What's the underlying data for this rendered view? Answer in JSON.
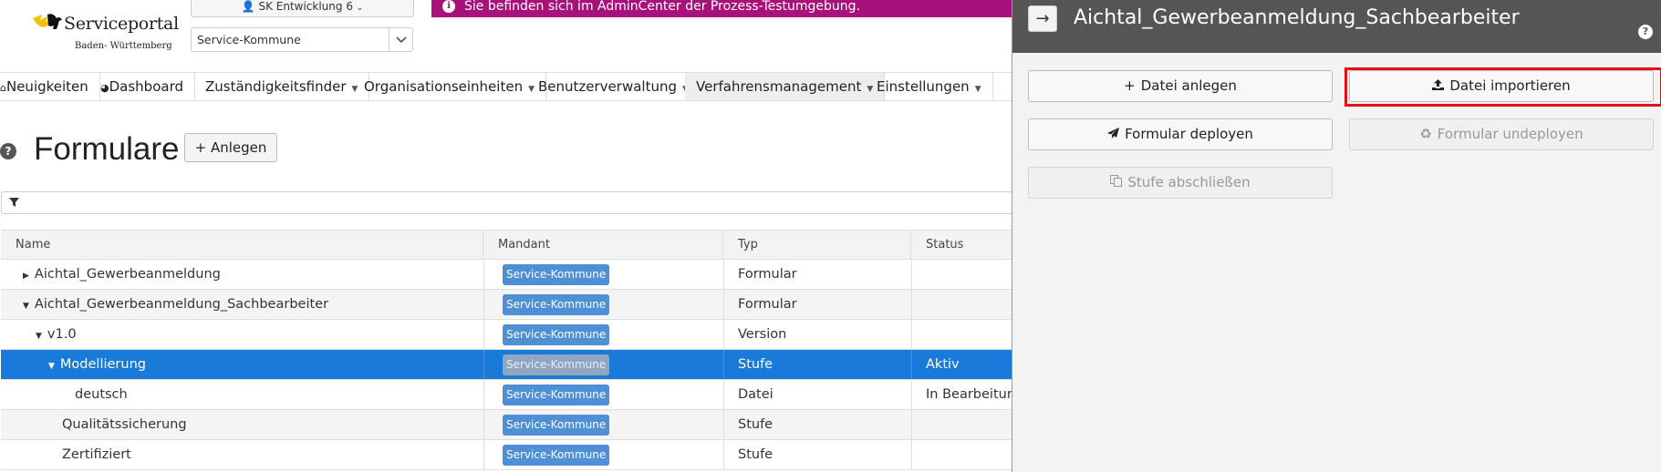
{
  "header": {
    "logo_title": "Serviceportal",
    "logo_subtitle": "Baden- Württemberg",
    "user_label": "SK Entwicklung 6",
    "mandant_value": "Service-Kommune",
    "info_banner": "Sie befinden sich im AdminCenter der Prozess-Testumgebung."
  },
  "nav": {
    "items": [
      {
        "label": "Neuigkeiten"
      },
      {
        "label": "Dashboard"
      },
      {
        "label": "Zuständigkeitsfinder"
      },
      {
        "label": "Organisationseinheiten"
      },
      {
        "label": "Benutzerverwaltung"
      },
      {
        "label": "Verfahrensmanagement"
      },
      {
        "label": "Einstellungen"
      }
    ]
  },
  "page": {
    "title": "Formulare",
    "add_label": "Anlegen"
  },
  "table": {
    "columns": [
      "Name",
      "Mandant",
      "Typ",
      "Status"
    ],
    "rows": [
      {
        "name": "Aichtal_Gewerbeanmeldung",
        "mandant": "Service-Kommune",
        "typ": "Formular",
        "status": ""
      },
      {
        "name": "Aichtal_Gewerbeanmeldung_Sachbearbeiter",
        "mandant": "Service-Kommune",
        "typ": "Formular",
        "status": ""
      },
      {
        "name": "v1.0",
        "mandant": "Service-Kommune",
        "typ": "Version",
        "status": ""
      },
      {
        "name": "Modellierung",
        "mandant": "Service-Kommune",
        "typ": "Stufe",
        "status": "Aktiv"
      },
      {
        "name": "deutsch",
        "mandant": "Service-Kommune",
        "typ": "Datei",
        "status": "In Bearbeitung"
      },
      {
        "name": "Qualitätssicherung",
        "mandant": "Service-Kommune",
        "typ": "Stufe",
        "status": ""
      },
      {
        "name": "Zertifiziert",
        "mandant": "Service-Kommune",
        "typ": "Stufe",
        "status": ""
      }
    ]
  },
  "panel": {
    "title": "Aichtal_Gewerbeanmeldung_Sachbearbeiter",
    "buttons": {
      "datei_anlegen": "Datei anlegen",
      "datei_importieren": "Datei importieren",
      "formular_deployen": "Formular deployen",
      "formular_undeployen": "Formular undeployen",
      "stufe_abschliessen": "Stufe abschließen"
    }
  },
  "colors": {
    "banner": "#a8117b",
    "selected_row": "#1a7ad9",
    "badge": "#4f8fd6",
    "panel_header": "#555555",
    "highlight": "#e0131b"
  }
}
